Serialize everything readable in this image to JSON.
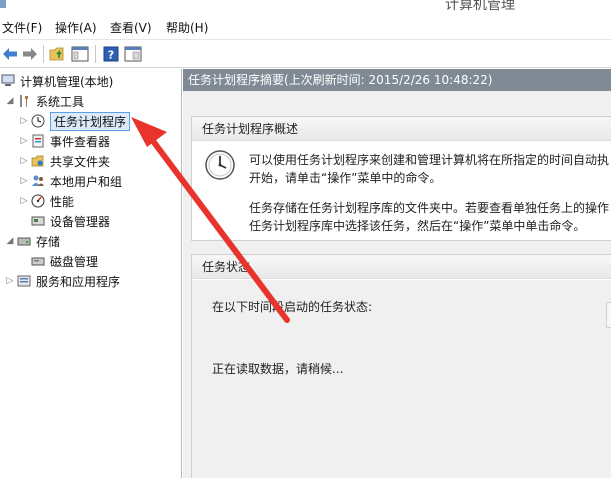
{
  "window": {
    "title": "计算机管理"
  },
  "menu": [
    {
      "label": "文件(F)"
    },
    {
      "label": "操作(A)"
    },
    {
      "label": "查看(V)"
    },
    {
      "label": "帮助(H)"
    }
  ],
  "toolbar": {
    "buttons": [
      "back-arrow-icon",
      "forward-arrow-icon",
      "folder-up-icon",
      "show-hide-tree-icon",
      "help-icon",
      "properties-pane-icon"
    ]
  },
  "tree": {
    "root": "计算机管理(本地)",
    "system_tools": "系统工具",
    "task_scheduler": "任务计划程序",
    "event_viewer": "事件查看器",
    "shared_folders": "共享文件夹",
    "local_users": "本地用户和组",
    "performance": "性能",
    "device_manager": "设备管理器",
    "storage": "存储",
    "disk_management": "磁盘管理",
    "services_apps": "服务和应用程序"
  },
  "content": {
    "header": "任务计划程序摘要(上次刷新时间: 2015/2/26 10:48:22)",
    "overview": {
      "title": "任务计划程序概述",
      "line1": "可以使用任务计划程序来创建和管理计算机将在所指定的时间自动执",
      "line2": "开始，请单击“操作”菜单中的命令。",
      "line3": "任务存储在任务计划程序库的文件夹中。若要查看单独任务上的操作",
      "line4": "任务计划程序库中选择该任务，然后在“操作”菜单中单击命令。"
    },
    "status": {
      "title": "任务状态",
      "label": "在以下时间段启动的任务状态:",
      "loading": "正在读取数据，请稍候..."
    }
  },
  "colors": {
    "header_bg": "#7f8a94",
    "selection_border": "#5aa0e6",
    "selection_bg": "#dceafa",
    "annotation_arrow": "#e8342c"
  }
}
